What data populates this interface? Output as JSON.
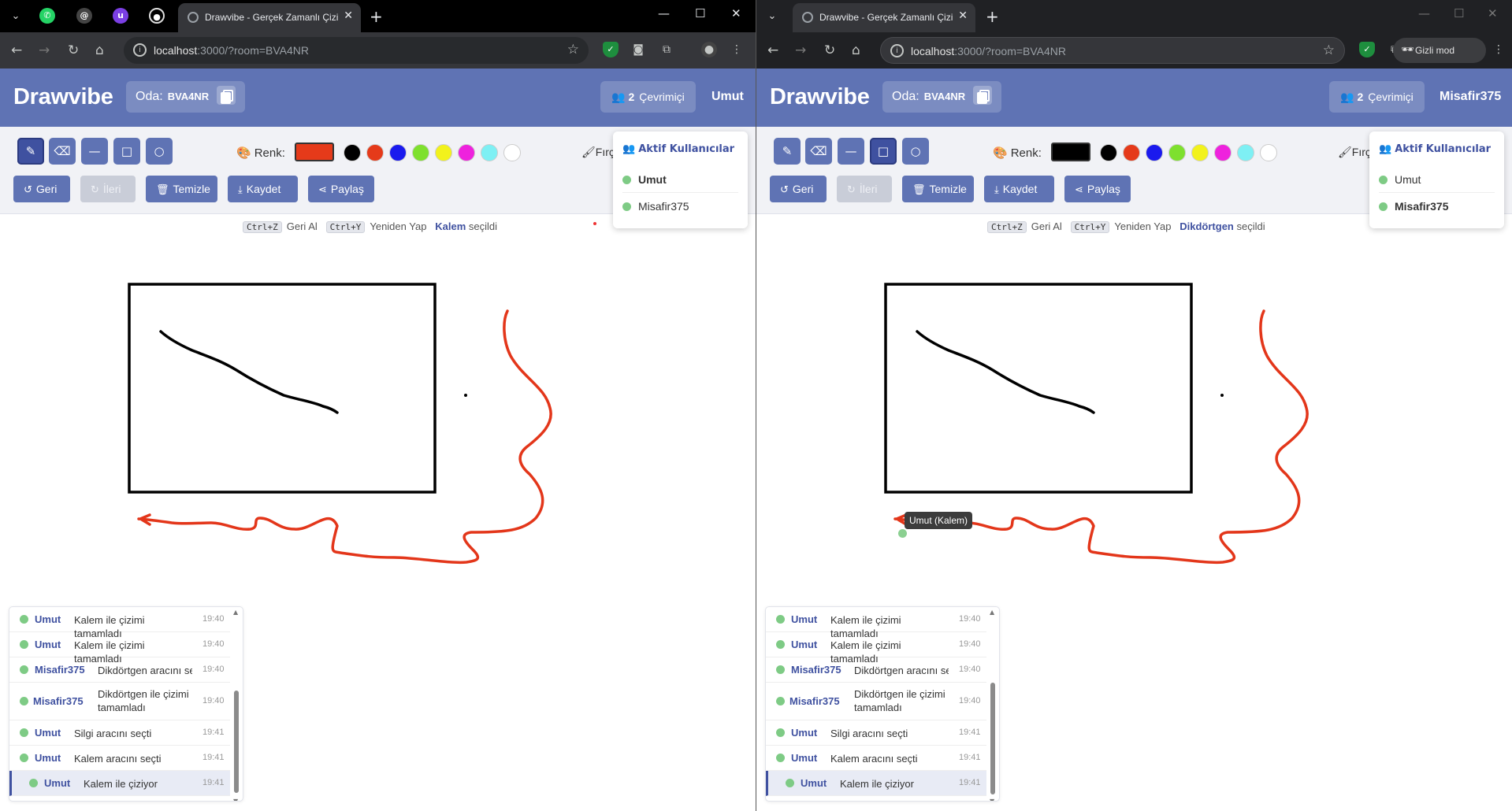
{
  "browser": {
    "tab_title": "Drawvibe - Gerçek Zamanlı Çizim",
    "url_host": "localhost",
    "url_rest": ":3000/?room=BVA4NR",
    "incognito_label": "Gizli mod"
  },
  "app": {
    "logo": "Drawvibe",
    "room_label": "Oda:",
    "room_code": "BVA4NR",
    "online_count": "2",
    "online_label": "Çevrimiçi",
    "color_label": "Renk:",
    "brush_label": "Fırç",
    "actions": {
      "undo": "Geri",
      "redo": "İleri",
      "clear": "Temizle",
      "save": "Kaydet",
      "share": "Paylaş"
    },
    "hints": {
      "undo_key": "Ctrl+Z",
      "undo_text": "Geri Al",
      "redo_key": "Ctrl+Y",
      "redo_text": "Yeniden Yap",
      "selected_suffix": "seçildi"
    },
    "palette": [
      "#000000",
      "#e53a1a",
      "#1a1aee",
      "#7ee02e",
      "#f2f21c",
      "#ee22dd",
      "#7ef0f4",
      "#ffffff"
    ],
    "users_title": "Aktif Kullanıcılar",
    "users": [
      "Umut",
      "Misafir375"
    ]
  },
  "left": {
    "username": "Umut",
    "current_color": "#e53a1a",
    "selected_tool": "Kalem"
  },
  "right": {
    "username": "Misafir375",
    "current_color": "#000000",
    "selected_tool": "Dikdörtgen",
    "cursor_tooltip": "Umut (Kalem)"
  },
  "log": [
    {
      "who": "Umut",
      "msg": "Kalem ile çizimi tamamladı",
      "time": "19:40"
    },
    {
      "who": "Umut",
      "msg": "Kalem ile çizimi tamamladı",
      "time": "19:40"
    },
    {
      "who": "Misafir375",
      "msg": "Dikdörtgen aracını seçti",
      "time": "19:40"
    },
    {
      "who": "Misafir375",
      "msg": "Dikdörtgen ile çizimi tamamladı",
      "time": "19:40"
    },
    {
      "who": "Umut",
      "msg": "Silgi aracını seçti",
      "time": "19:41"
    },
    {
      "who": "Umut",
      "msg": "Kalem aracını seçti",
      "time": "19:41"
    },
    {
      "who": "Umut",
      "msg": "Kalem ile çiziyor",
      "time": "19:41"
    }
  ],
  "colors": {
    "accent": "#5f73b4",
    "accent_dark": "#3f51a0",
    "online_dot": "#7ecb85",
    "stroke_red": "#e3361a"
  }
}
